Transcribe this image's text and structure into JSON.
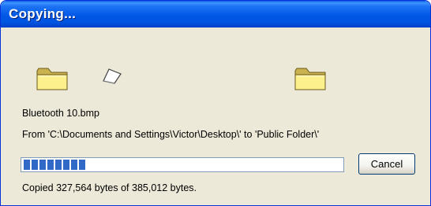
{
  "window": {
    "title": "Copying..."
  },
  "icons": {
    "source": "folder-icon",
    "flying": "paper-sheet-icon",
    "destination": "folder-icon"
  },
  "file": {
    "name": "Bluetooth 10.bmp",
    "from_to": "From 'C:\\Documents and Settings\\Victor\\Desktop\\' to 'Public Folder\\'"
  },
  "progress": {
    "fraction": 0.2
  },
  "buttons": {
    "cancel_label": "Cancel"
  },
  "status": {
    "copied": "Copied 327,564 bytes of 385,012 bytes."
  },
  "colors": {
    "titlebar": "#0058e6",
    "progress_fill": "#3169c6",
    "dialog_bg": "#ece9d8"
  }
}
